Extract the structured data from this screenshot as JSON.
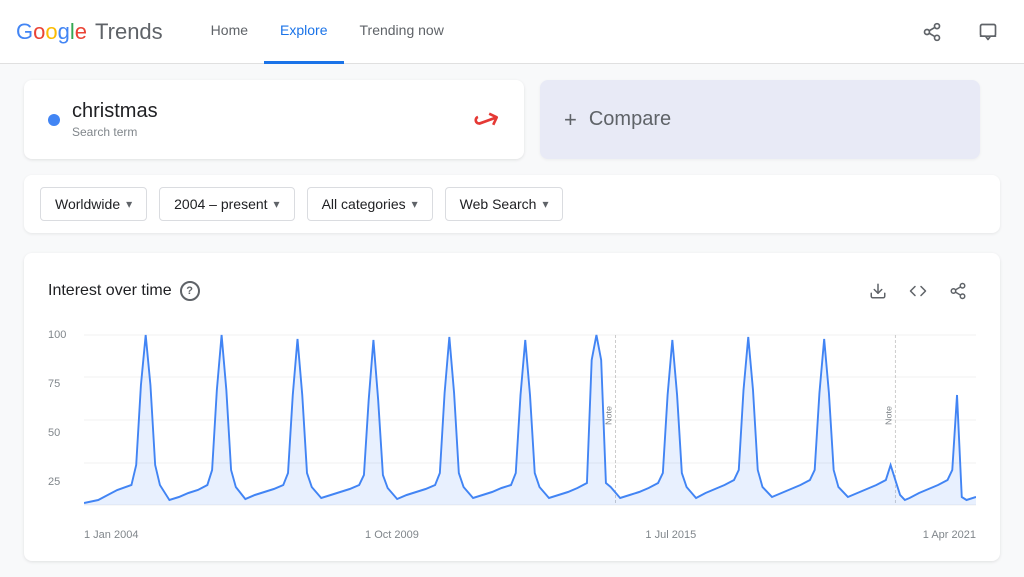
{
  "header": {
    "logo": {
      "google": "Google",
      "trends": "Trends"
    },
    "nav": [
      {
        "id": "home",
        "label": "Home",
        "active": false
      },
      {
        "id": "explore",
        "label": "Explore",
        "active": true
      },
      {
        "id": "trending",
        "label": "Trending now",
        "active": false
      }
    ],
    "actions": [
      {
        "id": "share",
        "icon": "⬡",
        "label": "share-icon"
      },
      {
        "id": "feedback",
        "icon": "⬡",
        "label": "feedback-icon"
      }
    ]
  },
  "search": {
    "term": "christmas",
    "term_type": "Search term",
    "dot_color": "#4285F4"
  },
  "compare": {
    "label": "Compare",
    "plus": "+"
  },
  "filters": [
    {
      "id": "region",
      "label": "Worldwide",
      "selected": true
    },
    {
      "id": "timerange",
      "label": "2004 – present",
      "selected": true
    },
    {
      "id": "category",
      "label": "All categories",
      "selected": true
    },
    {
      "id": "type",
      "label": "Web Search",
      "selected": true
    }
  ],
  "chart": {
    "title": "Interest over time",
    "help": "?",
    "actions": [
      {
        "id": "download",
        "icon": "↓",
        "label": "download-icon"
      },
      {
        "id": "embed",
        "icon": "<>",
        "label": "embed-icon"
      },
      {
        "id": "share",
        "icon": "⬡",
        "label": "share-icon"
      }
    ],
    "y_axis": [
      "100",
      "75",
      "50",
      "25"
    ],
    "x_axis": [
      "1 Jan 2004",
      "1 Oct 2009",
      "1 Jul 2015",
      "1 Apr 2021"
    ],
    "line_color": "#4285F4"
  }
}
